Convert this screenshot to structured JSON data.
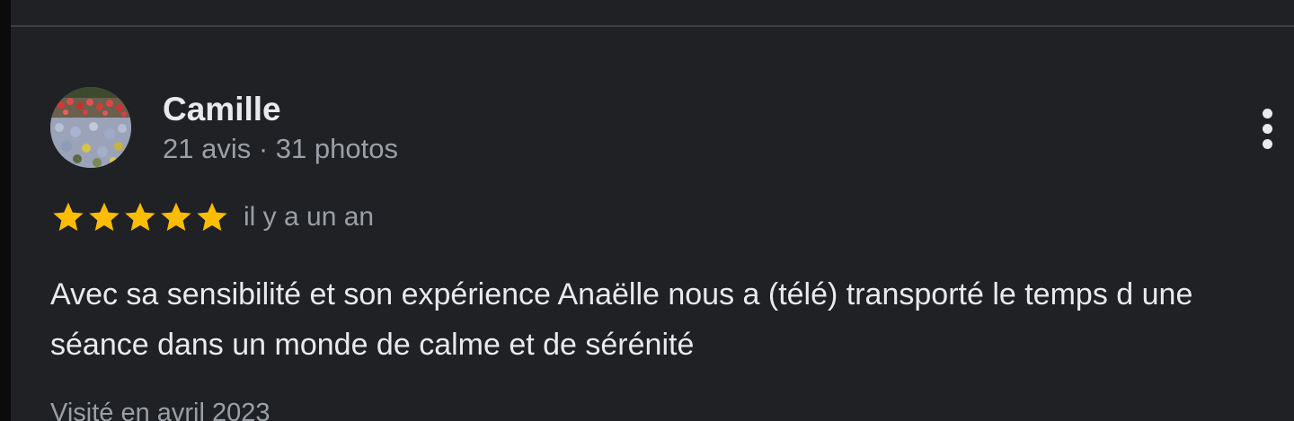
{
  "review": {
    "reviewer": {
      "name": "Camille",
      "meta": "21 avis · 31 photos",
      "avatar_icon": "avatar-photo-flowers"
    },
    "rating": {
      "stars": 5,
      "max": 5,
      "star_icon": "star-icon",
      "star_color": "#fbbc04"
    },
    "date": "il y a un an",
    "text": "Avec sa sensibilité et son expérience Anaëlle nous a (télé) transporté le temps d une séance dans un monde de calme et de sérénité",
    "visit": "Visité en avril 2023",
    "more_icon": "more-vert-icon"
  },
  "colors": {
    "background": "#202124",
    "primary_text": "#e8eaed",
    "secondary_text": "#9aa0a6",
    "divider": "#3c4043"
  }
}
